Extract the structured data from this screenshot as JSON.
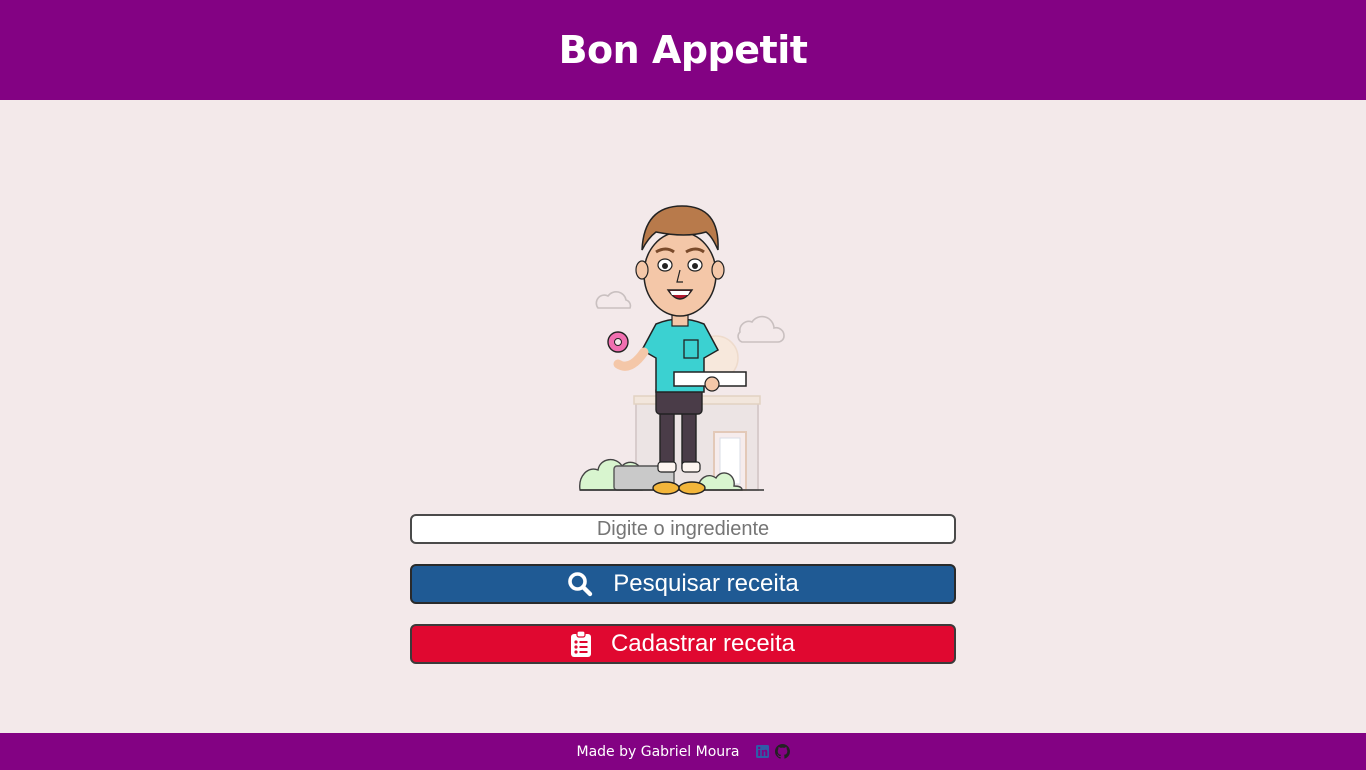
{
  "header": {
    "title": "Bon Appetit"
  },
  "search": {
    "placeholder": "Digite o ingrediente",
    "value": ""
  },
  "buttons": {
    "search_label": "Pesquisar receita",
    "search_icon": "search-icon",
    "register_label": "Cadastrar receita",
    "register_icon": "clipboard-list-icon"
  },
  "footer": {
    "credit": "Made by Gabriel Moura",
    "links": [
      {
        "icon": "linkedin-icon"
      },
      {
        "icon": "github-icon"
      }
    ]
  },
  "colors": {
    "brand_purple": "#830283",
    "background": "#f3e9ea",
    "search_button": "#1f5a94",
    "register_button": "#e00830"
  }
}
